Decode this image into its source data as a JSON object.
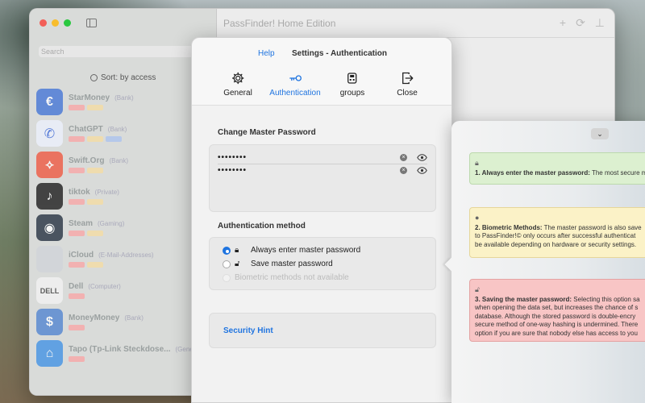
{
  "window": {
    "title": "PassFinder! Home Edition"
  },
  "sidebar": {
    "search_placeholder": "Search",
    "sort_label": "Sort: by access",
    "items": [
      {
        "title": "StarMoney",
        "category": "(Bank)",
        "icon": "starmoney-icon",
        "color": "#3b6fd6",
        "glyph": "€"
      },
      {
        "title": "ChatGPT",
        "category": "(Bank)",
        "icon": "phone-icon",
        "color": "#eef2ff",
        "glyph": "✆"
      },
      {
        "title": "Swift.Org",
        "category": "(Bank)",
        "icon": "swift-icon",
        "color": "#f05138",
        "glyph": "⟡"
      },
      {
        "title": "tiktok",
        "category": "(Private)",
        "icon": "tiktok-icon",
        "color": "#111111",
        "glyph": "♪"
      },
      {
        "title": "Steam",
        "category": "(Gaming)",
        "icon": "steam-icon",
        "color": "#1b2838",
        "glyph": "◉"
      },
      {
        "title": "iCloud",
        "category": "(E-Mail-Addresses)",
        "icon": "apple-icon",
        "color": "#cfd3d8",
        "glyph": ""
      },
      {
        "title": "Dell",
        "category": "(Computer)",
        "icon": "dell-icon",
        "color": "#f4f4f4",
        "glyph": "DELL"
      },
      {
        "title": "MoneyMoney",
        "category": "(Bank)",
        "icon": "moneymoney-icon",
        "color": "#4a7fd0",
        "glyph": "$"
      },
      {
        "title": "Tapo (Tp-Link Steckdose...",
        "category": "(Gener",
        "icon": "home-icon",
        "color": "#3a8ee6",
        "glyph": "⌂"
      }
    ]
  },
  "sheet": {
    "help_label": "Help",
    "title": "Settings - Authentication",
    "tabs": [
      {
        "label": "General",
        "icon": "gear-icon"
      },
      {
        "label": "Authentication",
        "icon": "key-icon"
      },
      {
        "label": "groups",
        "icon": "groups-icon"
      },
      {
        "label": "Close",
        "icon": "exit-icon"
      }
    ],
    "active_tab": "Authentication",
    "change_pw_label": "Change Master Password",
    "pw1": "••••••••",
    "pw2": "••••••••",
    "auth_label": "Authentication method",
    "opt1": "Always enter master password",
    "opt2": "Save master password",
    "opt3": "Biometric methods not available",
    "selected_option": "Always enter master password",
    "security_hint": "Security Hint"
  },
  "popover": {
    "notes": [
      {
        "title": "1. Always enter the master password:",
        "lines": [
          "The most secure m"
        ]
      },
      {
        "title": "2. Biometric Methods:",
        "lines": [
          "The master password is also save",
          "to PassFinder!© only occurs after successful authenticat",
          "be available depending on hardware or security settings."
        ]
      },
      {
        "title": "3. Saving the master password:",
        "lines": [
          "Selecting this option sa",
          "when opening the data set, but increases the chance of s",
          "database. Although the stored password is double-encry",
          "secure method of one-way hashing is undermined. There",
          "option if you are sure that nobody else has access to you"
        ]
      }
    ]
  },
  "colors": {
    "accent": "#1f74e0",
    "green_note": "#dcf0d0",
    "yellow_note": "#fbf2c7",
    "red_note": "#f8c5c5"
  }
}
